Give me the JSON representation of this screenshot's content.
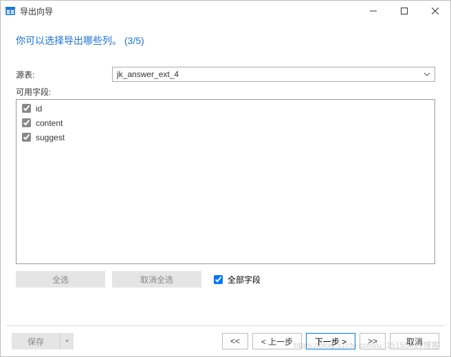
{
  "window": {
    "title": "导出向导"
  },
  "subtitle": "你可以选择导出哪些列。 (3/5)",
  "source": {
    "label": "源表:",
    "selected": "jk_answer_ext_4"
  },
  "fields": {
    "label": "可用字段:",
    "items": [
      {
        "name": "id",
        "checked": true
      },
      {
        "name": "content",
        "checked": true
      },
      {
        "name": "suggest",
        "checked": true
      }
    ]
  },
  "buttons": {
    "select_all": "全选",
    "deselect_all": "取消全选",
    "all_fields": "全部字段",
    "save": "保存",
    "first": "<<",
    "prev": "< 上一步",
    "next": "下一步 >",
    "last": ">>",
    "cancel": "取消"
  },
  "watermark": "https://blog.51cto.com/u_15155419博客"
}
